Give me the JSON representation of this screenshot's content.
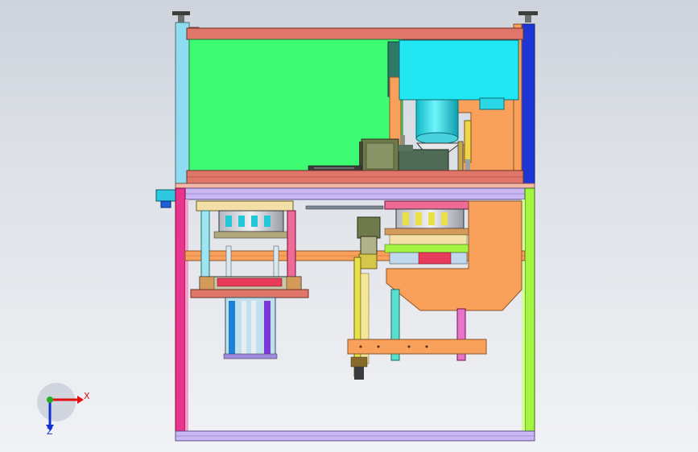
{
  "viewport": {
    "background": "#dde1e7"
  },
  "triad": {
    "x_label": "X",
    "z_label": "Z",
    "x_color": "#e01010",
    "y_color": "#20b020",
    "z_color": "#1030d0"
  },
  "model": {
    "palette": {
      "green_panel": "#3dfb73",
      "cyan_box": "#22e6f2",
      "blue_post": "#1f36d6",
      "orange_bracket": "#f9a15a",
      "salmon_plate": "#e0766a",
      "magenta_post": "#e9338c",
      "lime_post": "#a3f542",
      "olive_motor": "#6f7a4c",
      "yellow_rod": "#e8e24a",
      "lavender_rail": "#c9b8f2"
    }
  }
}
